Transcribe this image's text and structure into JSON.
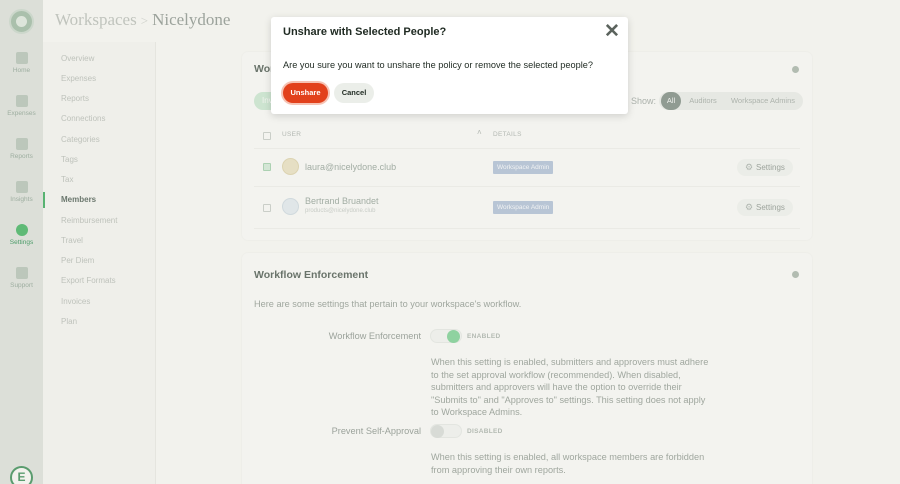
{
  "rail": {
    "items": [
      {
        "label": "Home",
        "icon": "home-icon"
      },
      {
        "label": "Expenses",
        "icon": "receipt-icon"
      },
      {
        "label": "Reports",
        "icon": "document-icon"
      },
      {
        "label": "Insights",
        "icon": "pin-icon"
      },
      {
        "label": "Settings",
        "icon": "gear-icon"
      },
      {
        "label": "Support",
        "icon": "chat-icon"
      }
    ],
    "bottom_badge": "E",
    "accent": "#41b05f"
  },
  "breadcrumb": {
    "root": "Workspaces",
    "separator": ">",
    "current": "Nicelydone"
  },
  "subnav": {
    "items": [
      "Overview",
      "Expenses",
      "Reports",
      "Connections",
      "Categories",
      "Tags",
      "Tax",
      "Members",
      "Reimbursement",
      "Travel",
      "Per Diem",
      "Export Formats",
      "Invoices",
      "Plan"
    ],
    "active": "Members"
  },
  "members": {
    "title_fragment": "Wor",
    "invite_fragment": "Inv",
    "show_label": "Show:",
    "filters": [
      "All",
      "Auditors",
      "Workspace Admins"
    ],
    "active_filter": "All",
    "columns": {
      "user": "USER",
      "details": "DETAILS",
      "sort_indicator": "˄"
    },
    "rows": [
      {
        "name": "laura@nicelydone.club",
        "sub": "",
        "role": "Workspace Admin",
        "settings": "Settings",
        "checked": true
      },
      {
        "name": "Bertrand Bruandet",
        "sub": "products@nicelydone.club",
        "role": "Workspace Admin",
        "settings": "Settings",
        "checked": false
      }
    ]
  },
  "workflow": {
    "title": "Workflow Enforcement",
    "intro": "Here are some settings that pertain to your workspace's workflow.",
    "settings": [
      {
        "label": "Workflow Enforcement",
        "state": "ENABLED",
        "description_lines": [
          "When this setting is enabled, submitters and approvers must adhere",
          "to the set approval workflow (recommended). When disabled,",
          "submitters and approvers will have the option to override their",
          "\"Submits to\" and \"Approves to\" settings. This setting does not apply",
          "to Workspace Admins."
        ]
      },
      {
        "label": "Prevent Self-Approval",
        "state": "DISABLED",
        "description_lines": [
          "When this setting is enabled, all workspace members are forbidden",
          "from approving their own reports."
        ]
      }
    ]
  },
  "modal": {
    "title": "Unshare with Selected People?",
    "close_glyph": "✕",
    "body": "Are you sure you want to unshare the policy or remove the selected people?",
    "confirm_label": "Unshare",
    "cancel_label": "Cancel",
    "confirm_color": "#e2411c"
  }
}
